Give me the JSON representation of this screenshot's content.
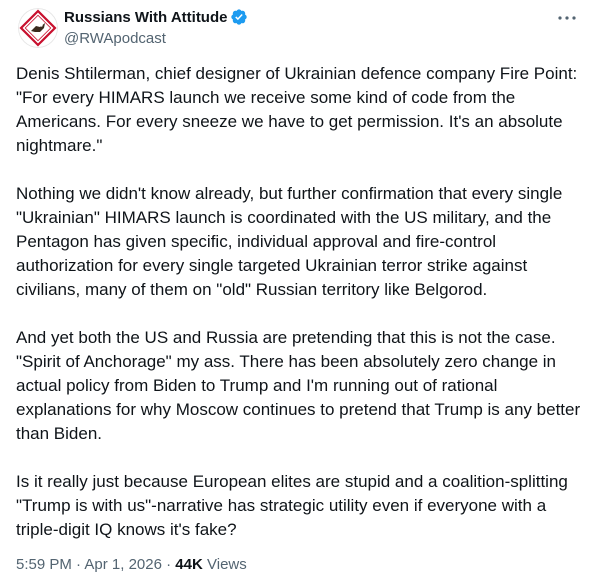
{
  "author": {
    "display_name": "Russians With Attitude",
    "handle": "@RWApodcast",
    "verified": true,
    "avatar_icon": "diamond-sign-logo-icon",
    "verified_color": "#1d9bf0"
  },
  "tweet": {
    "paragraphs": [
      "Denis Shtilerman, chief designer of Ukrainian defence company Fire Point: \"For every HIMARS launch we receive some kind of code from the Americans. For every sneeze we have to get permission. It's an absolute nightmare.\"",
      "Nothing we didn't know already, but further confirmation that every single \"Ukrainian\" HIMARS launch is coordinated with the US military, and the Pentagon has given specific, individual approval and fire-control authorization for every single targeted Ukrainian terror strike against civilians, many of them on \"old\" Russian territory like Belgorod.",
      "And yet both the US and Russia are pretending that this is not the case. \"Spirit of Anchorage\" my ass. There has been absolutely zero change in actual policy from Biden to Trump and I'm running out of rational explanations for why Moscow continues to pretend that Trump is any better than Biden.",
      "Is it really just because European elites are stupid and a coalition-splitting \"Trump is with us\"-narrative has strategic utility even if everyone with a triple-digit IQ knows it's fake?"
    ]
  },
  "meta": {
    "time": "5:59 PM",
    "separator": "·",
    "date": "Apr 1, 2026",
    "views_count": "44K",
    "views_label": "Views"
  },
  "more_icon": "more-horizontal-icon"
}
